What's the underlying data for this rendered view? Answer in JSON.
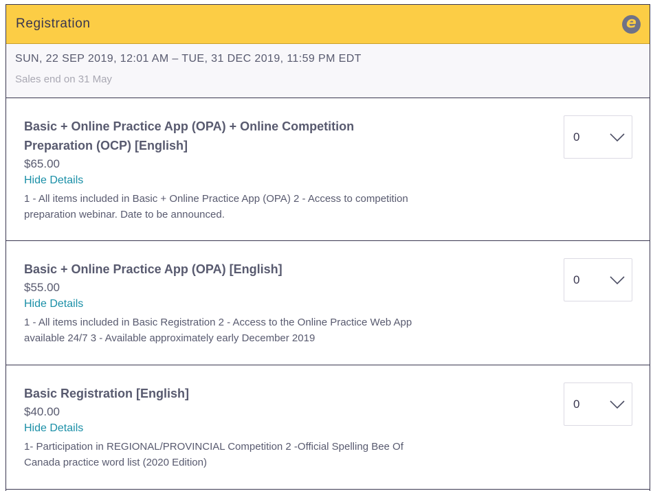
{
  "header": {
    "title": "Registration",
    "brand_icon": "eventbrite-e-icon",
    "brand_letter": "e"
  },
  "event": {
    "date_range": "SUN, 22 SEP 2019, 12:01 AM – TUE, 31 DEC 2019, 11:59 PM EDT",
    "sales_end": "Sales end on 31 May"
  },
  "tickets": [
    {
      "name": "Basic + Online Practice App (OPA) + Online Competition Preparation (OCP) [English]",
      "price": "$65.00",
      "toggle_label": "Hide Details",
      "description": "1 - All items included in Basic + Online Practice App (OPA) 2 - Access to competition preparation webinar. Date to be announced.",
      "quantity": "0"
    },
    {
      "name": "Basic + Online Practice App (OPA) [English]",
      "price": "$55.00",
      "toggle_label": "Hide Details",
      "description": "1 - All items included in Basic Registration 2 - Access to the Online Practice Web App available 24/7 3 - Available approximately early December 2019",
      "quantity": "0"
    },
    {
      "name": "Basic Registration [English]",
      "price": "$40.00",
      "toggle_label": "Hide Details",
      "description": "1- Participation in REGIONAL/PROVINCIAL Competition 2 -Official Spelling Bee Of Canada practice word list (2020 Edition)",
      "quantity": "0"
    }
  ],
  "colors": {
    "header_bg": "#fccd45",
    "link": "#1a8fa7",
    "text": "#585a6f",
    "muted": "#a9a8b3",
    "border": "#39364f"
  }
}
